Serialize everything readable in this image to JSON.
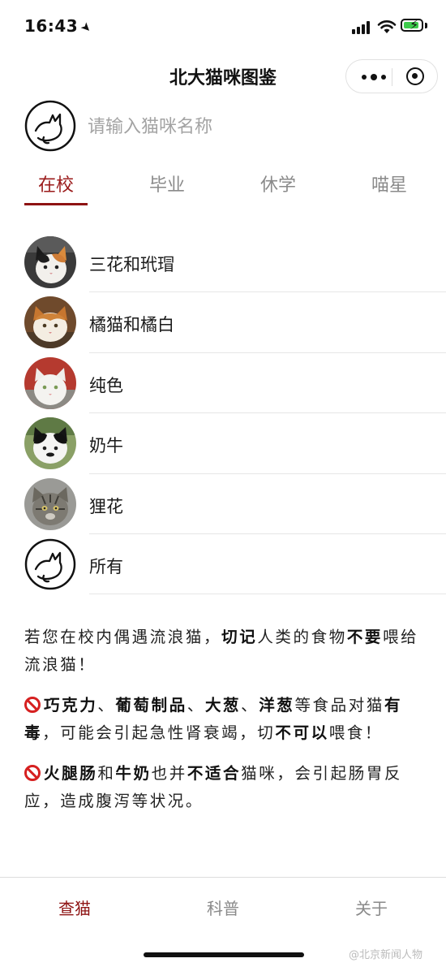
{
  "status_bar": {
    "time": "16:43"
  },
  "nav": {
    "title": "北大猫咪图鉴"
  },
  "search": {
    "placeholder": "请输入猫咪名称"
  },
  "tabs": [
    {
      "label": "在校",
      "active": true
    },
    {
      "label": "毕业",
      "active": false
    },
    {
      "label": "休学",
      "active": false
    },
    {
      "label": "喵星",
      "active": false
    }
  ],
  "categories": [
    {
      "label": "三花和玳瑁",
      "avatar": "calico-cat-photo"
    },
    {
      "label": "橘猫和橘白",
      "avatar": "orange-cat-photo"
    },
    {
      "label": "纯色",
      "avatar": "white-cat-photo"
    },
    {
      "label": "奶牛",
      "avatar": "tuxedo-cat-photo"
    },
    {
      "label": "狸花",
      "avatar": "tabby-cat-photo"
    },
    {
      "label": "所有",
      "avatar": "cat-logo-icon"
    }
  ],
  "notice": {
    "p1": {
      "a": "若您在校内偶遇流浪猫，",
      "b": "切记",
      "c": "人类的食物",
      "d": "不要",
      "e": "喂给流浪猫！"
    },
    "p2": {
      "a": "巧克力",
      "b": "、",
      "c": "葡萄制品",
      "d": "、",
      "e": "大葱",
      "f": "、",
      "g": "洋葱",
      "h": "等食品对猫",
      "i": "有毒",
      "j": "，可能会引起急性肾衰竭，切",
      "k": "不可以",
      "l": "喂食！"
    },
    "p3": {
      "a": "火腿肠",
      "b": "和",
      "c": "牛奶",
      "d": "也并",
      "e": "不适合",
      "f": "猫咪，会引起肠胃反应，造成腹泻等状况。"
    }
  },
  "tabbar": [
    {
      "label": "查猫",
      "active": true
    },
    {
      "label": "科普",
      "active": false
    },
    {
      "label": "关于",
      "active": false
    }
  ],
  "watermark": "@北京新闻人物",
  "colors": {
    "accent": "#8e1313",
    "ban": "#d62020"
  }
}
